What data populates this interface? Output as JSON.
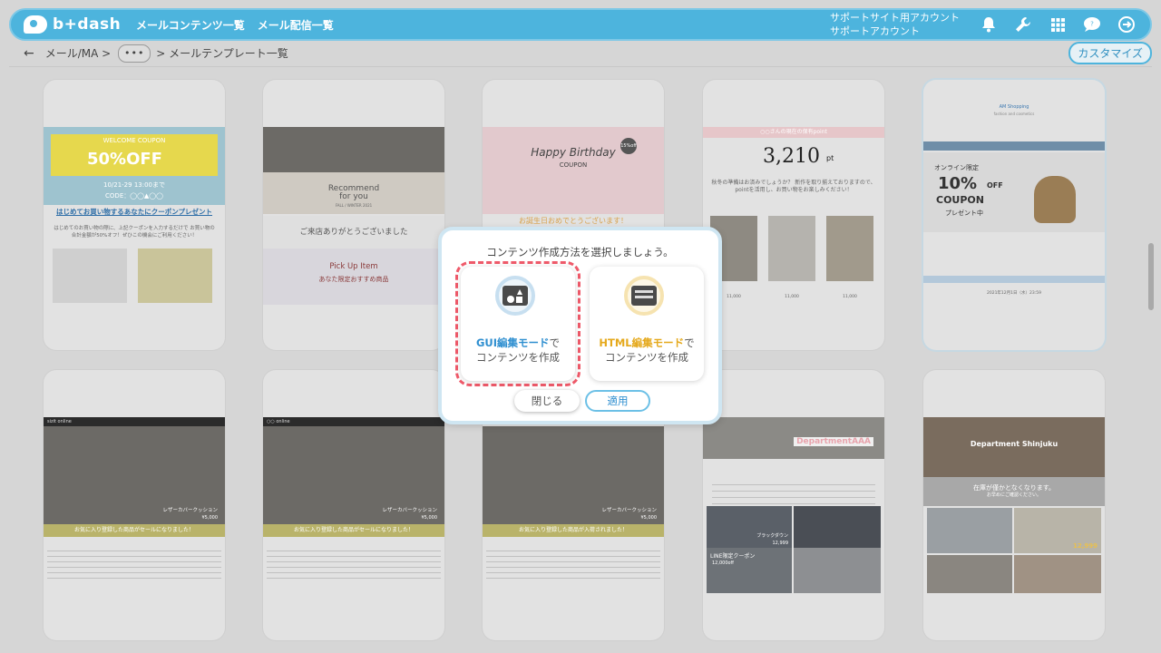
{
  "header": {
    "logo_text": "b+dash",
    "nav": [
      "メールコンテンツ一覧",
      "メール配信一覧"
    ],
    "account_line1": "サポートサイト用アカウント",
    "account_line2": "サポートアカウント",
    "icons": [
      "bell-icon",
      "wrench-icon",
      "grid-icon",
      "chat-icon",
      "logout-icon"
    ]
  },
  "breadcrumb": {
    "back": "←",
    "crumb1": "メール/MA >",
    "dots": "•••",
    "crumb2": "> メールテンプレート一覧",
    "customize": "カスタマイズ"
  },
  "cards": {
    "c1": {
      "header": "WELCOME COUPON",
      "big": "50%OFF",
      "date": "10/21-29 13:00まで",
      "code": "CODE：◯◯▲◯◯",
      "title": "はじめてお買い物するあなたにクーポンプレゼント",
      "note": "はじめてのお買い物の際に、上記クーポンを入力するだけで お買い物の合計金額が50%オフ！ぜひこの機会にご利用ください！"
    },
    "c2": {
      "recommend": "Recommend",
      "foryou": "for you",
      "season": "FALL / WINTER 2021",
      "thanks": "ご来店ありがとうございました",
      "pickup": "Pick Up Item",
      "limited": "あなた限定おすすめ商品"
    },
    "c3": {
      "happy": "Happy Birthday",
      "coupon": "COUPON",
      "off": "15%off",
      "msg": "お誕生日おめでとうございます！"
    },
    "c4": {
      "top": "○○さんの現在の保有point",
      "points": "3,210",
      "unit": "pt",
      "note": "秋冬の準備はお済みでしょうか？ 新作を取り揃えておりますので、pointを活用し、お買い物をお楽しみください！",
      "prices": [
        "11,000",
        "11,000",
        "11,000"
      ]
    },
    "c5": {
      "brand": "AM Shopping",
      "sub": "fashion and cosmetics",
      "line1": "オンライン限定",
      "pct": "10%",
      "off": "OFF",
      "coupon": "COUPON",
      "present": "プレゼント中",
      "date": "2021年12月1日（水）23:59"
    },
    "c6": {
      "store": "sizit online",
      "caption": "レザーカバークッション",
      "price": "¥5,000",
      "banner": "お気に入り登録した商品がセールになりました！"
    },
    "c7": {
      "store": "○○ online",
      "caption": "レザーカバークッション",
      "price": "¥5,000",
      "banner": "お気に入り登録した商品がセールになりました！"
    },
    "c8": {
      "caption": "レザーカバークッション",
      "price": "¥5,000",
      "banner": "お気に入り登録した商品が入荷されました！"
    },
    "c9": {
      "brand": "DepartmentAAA",
      "item1": "ブラックダウン",
      "price1": "12,999",
      "coupon": "LINE限定クーポン",
      "coupon_val": "12,000off"
    },
    "c10": {
      "brand": "Department Shinjuku",
      "msg": "在庫が僅かとなくなります。",
      "sub": "お早めにご確認ください。",
      "price1": "12,999"
    }
  },
  "modal": {
    "title": "コンテンツ作成方法を選択しましょう。",
    "gui_accent": "GUI編集モード",
    "gui_suffix": "で",
    "gui_line2": "コンテンツを作成",
    "html_accent": "HTML編集モード",
    "html_suffix": "で",
    "html_line2": "コンテンツを作成",
    "close_label": "閉じる",
    "apply_label": "適用",
    "accent_color": "#4db4dd",
    "selected_outline_color": "#ef5a6a"
  }
}
